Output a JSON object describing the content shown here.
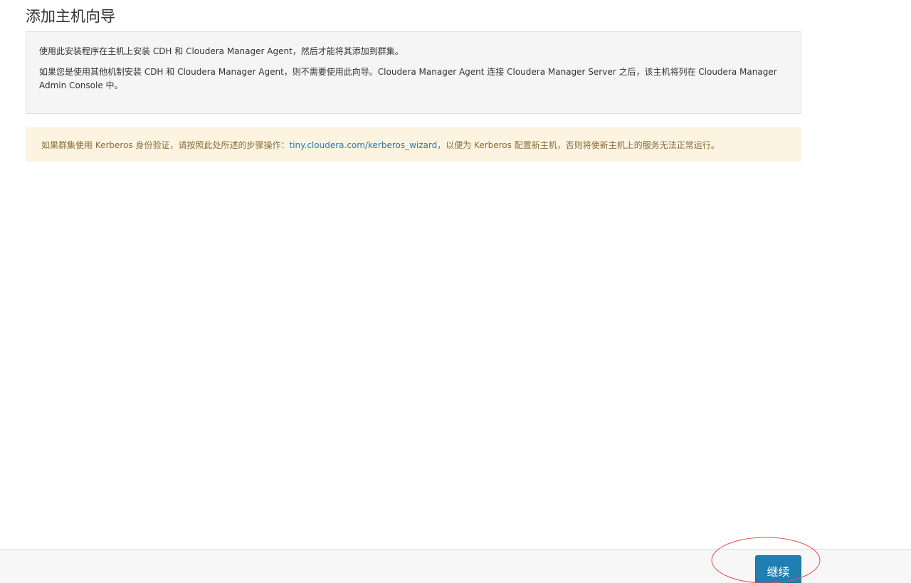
{
  "page": {
    "title": "添加主机向导"
  },
  "info_panel": {
    "line1": "使用此安装程序在主机上安装 CDH 和 Cloudera Manager Agent，然后才能将其添加到群集。",
    "line2": "如果您是使用其他机制安装 CDH 和 Cloudera Manager Agent，则不需要使用此向导。Cloudera Manager Agent 连接 Cloudera Manager Server 之后，该主机将列在 Cloudera Manager Admin Console 中。"
  },
  "warning": {
    "text_before": "如果群集使用 Kerberos 身份验证，请按照此处所述的步骤操作：",
    "link_text": "tiny.cloudera.com/kerberos_wizard",
    "text_after": "，以便为 Kerberos 配置新主机，否则将使新主机上的服务无法正常运行。"
  },
  "footer": {
    "continue_label": "继续"
  },
  "colors": {
    "button": "#1f7fb0",
    "warning_bg": "#fcf3e0",
    "warning_text": "#8a6d3b",
    "link": "#2a7ab0",
    "annotation": "#e05050"
  }
}
